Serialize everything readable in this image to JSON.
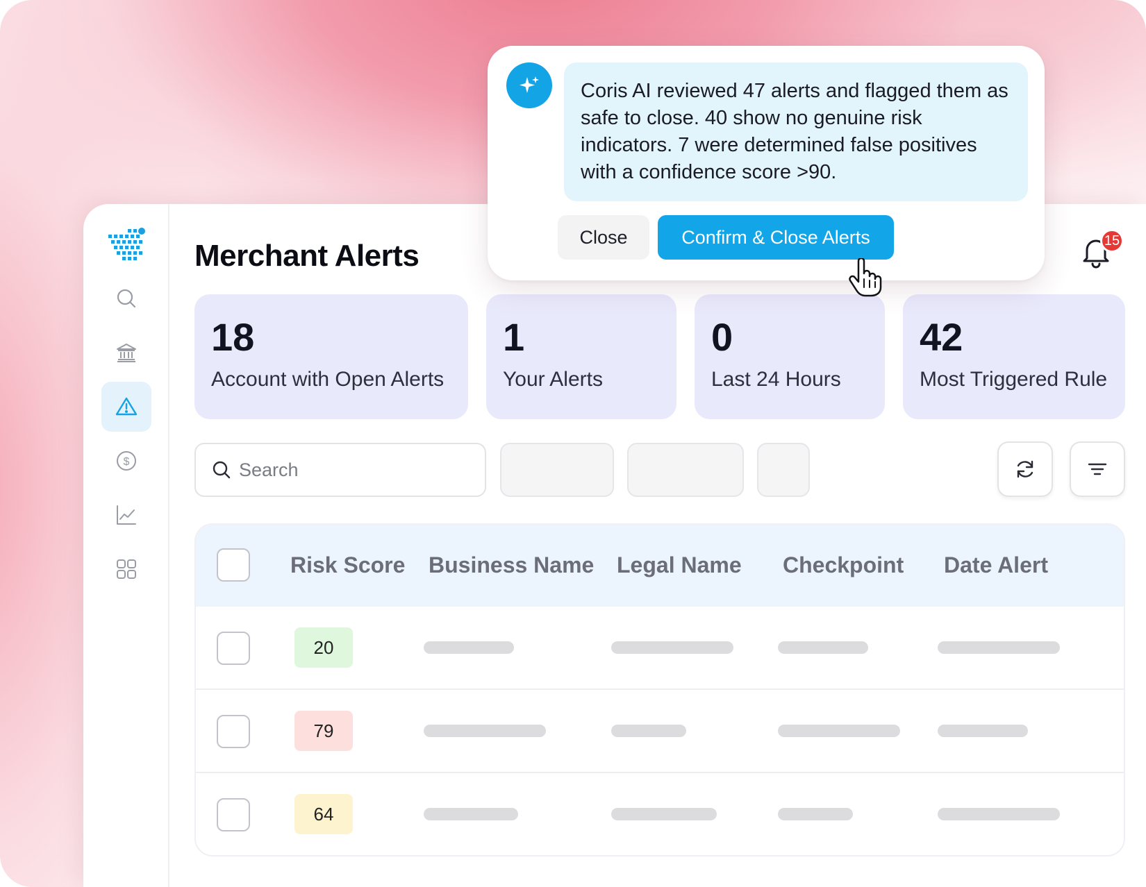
{
  "header": {
    "title": "Merchant Alerts",
    "notification_count": "15"
  },
  "sidebar": {
    "items": [
      {
        "icon": "search-icon",
        "active": false
      },
      {
        "icon": "bank-icon",
        "active": false
      },
      {
        "icon": "alert-triangle-icon",
        "active": true
      },
      {
        "icon": "dollar-circle-icon",
        "active": false
      },
      {
        "icon": "line-chart-icon",
        "active": false
      },
      {
        "icon": "grid-icon",
        "active": false
      }
    ]
  },
  "stats": [
    {
      "value": "18",
      "label": "Account with Open Alerts"
    },
    {
      "value": "1",
      "label": "Your Alerts"
    },
    {
      "value": "0",
      "label": "Last 24 Hours"
    },
    {
      "value": "42",
      "label": "Most Triggered Rule"
    }
  ],
  "toolbar": {
    "search_placeholder": "Search"
  },
  "table": {
    "columns": [
      "Risk Score",
      "Business Name",
      "Legal Name",
      "Checkpoint",
      "Date Alert"
    ],
    "rows": [
      {
        "risk_score": "20",
        "risk_level": "low"
      },
      {
        "risk_score": "79",
        "risk_level": "high"
      },
      {
        "risk_score": "64",
        "risk_level": "medium"
      }
    ]
  },
  "ai_popup": {
    "message": "Coris AI reviewed 47 alerts and flagged them as safe to close. 40 show no genuine risk indicators. 7 were determined false positives with a confidence score >90.",
    "close_label": "Close",
    "confirm_label": "Confirm & Close Alerts"
  },
  "colors": {
    "accent": "#12a5e8",
    "stat_card": "#e9e9fc",
    "risk_low": "#dff7dc",
    "risk_high": "#fde0de",
    "risk_medium": "#fdf4cf",
    "badge": "#e53935"
  }
}
